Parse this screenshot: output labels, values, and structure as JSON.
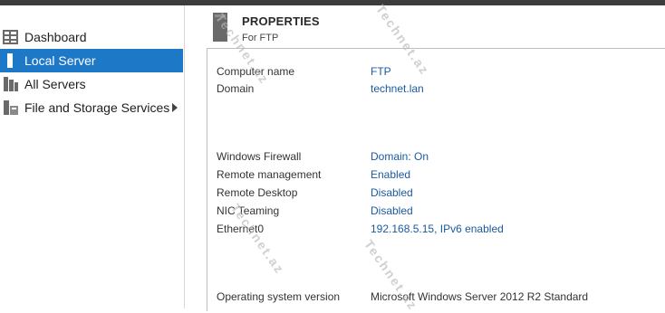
{
  "sidebar": {
    "items": [
      {
        "label": "Dashboard",
        "icon": "dashboard-icon"
      },
      {
        "label": "Local Server",
        "icon": "server-icon",
        "selected": true
      },
      {
        "label": "All Servers",
        "icon": "servers-icon"
      },
      {
        "label": "File and Storage Services",
        "icon": "storage-icon",
        "has_submenu": true
      }
    ]
  },
  "properties": {
    "title": "PROPERTIES",
    "subtitle": "For FTP",
    "rows": [
      {
        "key": "Computer name",
        "value": "FTP"
      },
      {
        "key": "Domain",
        "value": "technet.lan"
      },
      {
        "key": "Windows Firewall",
        "value": "Domain: On"
      },
      {
        "key": "Remote management",
        "value": "Enabled"
      },
      {
        "key": "Remote Desktop",
        "value": "Disabled"
      },
      {
        "key": "NIC Teaming",
        "value": "Disabled"
      },
      {
        "key": "Ethernet0",
        "value": "192.168.5.15, IPv6 enabled"
      },
      {
        "key": "Operating system version",
        "value": "Microsoft Windows Server 2012 R2 Standard"
      }
    ]
  },
  "watermark": "Technet.az",
  "colors": {
    "accent": "#1e78c8",
    "link": "#1a5aa0",
    "topbar": "#3c3c3c"
  }
}
